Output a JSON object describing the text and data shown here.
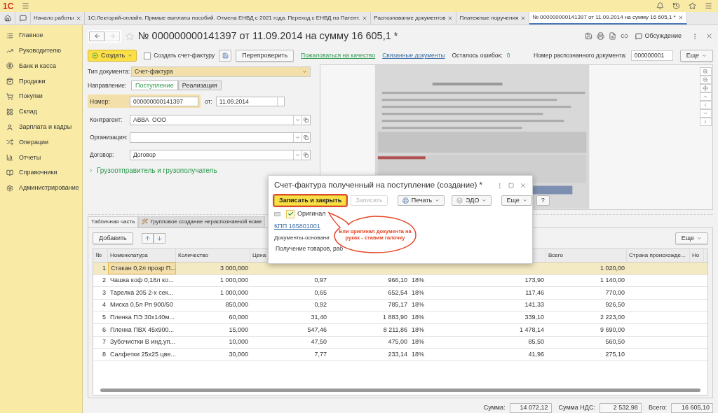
{
  "app_bar": {
    "logo": "1С"
  },
  "tabs": [
    {
      "label": "Начало работы",
      "selected": false
    },
    {
      "label": "1С:Лекторий-онлайн. Прямые выплаты пособий. Отмена ЕНВД с 2021 года. Переход с ЕНВД на Патент.",
      "selected": false
    },
    {
      "label": "Распознавание документов",
      "selected": false
    },
    {
      "label": "Платежные поручения",
      "selected": false
    },
    {
      "label": "№ 000000000141397 от 11.09.2014 на сумму 16 605,1 *",
      "selected": true
    }
  ],
  "sidebar": {
    "items": [
      {
        "label": "Главное"
      },
      {
        "label": "Руководителю"
      },
      {
        "label": "Банк и касса"
      },
      {
        "label": "Продажи"
      },
      {
        "label": "Покупки"
      },
      {
        "label": "Склад"
      },
      {
        "label": "Зарплата и кадры"
      },
      {
        "label": "Операции"
      },
      {
        "label": "Отчеты"
      },
      {
        "label": "Справочники"
      },
      {
        "label": "Администрирование"
      }
    ]
  },
  "document": {
    "title": "№ 000000000141397 от 11.09.2014 на сумму 16 605,1 *",
    "discussion": "Обсуждение"
  },
  "toolbar": {
    "create": "Создать",
    "create_invoice": {
      "label": "Создать счет-фактуру",
      "checked": false
    },
    "recheck": "Перепроверить",
    "complain": "Пожаловаться на качество",
    "related": "Связанные документы",
    "errors_label": "Осталось ошибок:",
    "errors_value": "0",
    "recognized_label": "Номер распознанного документа:",
    "recognized_value": "000000001",
    "more": "Еще"
  },
  "form": {
    "doc_type_label": "Тип документа:",
    "doc_type": "Счет-фактура",
    "direction_label": "Направление:",
    "directions": [
      {
        "label": "Поступление",
        "selected": true
      },
      {
        "label": "Реализация",
        "selected": false
      }
    ],
    "number_label": "Номер:",
    "number": "000000000141397",
    "date_label": "от:",
    "date": "11.09.2014",
    "fields": [
      {
        "label": "Контрагент:",
        "value": "АВВА  ООО"
      },
      {
        "label": "Организация:"
      },
      {
        "label": "Договор:",
        "value": "Договор"
      }
    ],
    "consignor": "Грузоотправитель и грузополучатель"
  },
  "table_tabs": [
    {
      "label": "Табличная часть",
      "selected": true
    },
    {
      "label": "Групповое создание нераспознанной номе",
      "selected": false
    }
  ],
  "table_toolbar": {
    "add": "Добавить",
    "more": "Еще"
  },
  "table": {
    "columns": [
      "№",
      "Номенклатура",
      "Количество",
      "Цена",
      "Всего",
      "Страна происхожде...",
      "Но"
    ],
    "rows": [
      {
        "n": "1",
        "name": "Стакан 0,2л прозр П...",
        "qty": "3 000,000",
        "total": "1 020,00",
        "selected": true
      },
      {
        "n": "2",
        "name": "Чашка коф 0,18л ко...",
        "qty": "1 000,000",
        "price": "0,97",
        "sum": "966,10",
        "rate": "18%",
        "vat": "173,90",
        "total": "1 140,00",
        "selected": false
      },
      {
        "n": "3",
        "name": "Тарелка 205 2-х сек...",
        "qty": "1 000,000",
        "price": "0,65",
        "sum": "652,54",
        "rate": "18%",
        "vat": "117,46",
        "total": "770,00",
        "selected": false
      },
      {
        "n": "4",
        "name": "Миска 0,5л Рп 900/50",
        "qty": "850,000",
        "price": "0,92",
        "sum": "785,17",
        "rate": "18%",
        "vat": "141,33",
        "total": "926,50",
        "selected": false
      },
      {
        "n": "5",
        "name": "Пленка ПЭ 30х140м...",
        "qty": "60,000",
        "price": "31,40",
        "sum": "1 883,90",
        "rate": "18%",
        "vat": "339,10",
        "total": "2 223,00",
        "selected": false
      },
      {
        "n": "6",
        "name": "Пленка ПВХ 45х900...",
        "qty": "15,000",
        "price": "547,46",
        "sum": "8 211,86",
        "rate": "18%",
        "vat": "1 478,14",
        "total": "9 690,00",
        "selected": false
      },
      {
        "n": "7",
        "name": "Зубочистки В инд.уп...",
        "qty": "10,000",
        "price": "47,50",
        "sum": "475,00",
        "rate": "18%",
        "vat": "85,50",
        "total": "560,50",
        "selected": false
      },
      {
        "n": "8",
        "name": "Салфетки 25х25 цве...",
        "qty": "30,000",
        "price": "7,77",
        "sum": "233,14",
        "rate": "18%",
        "vat": "41,96",
        "total": "275,10",
        "selected": false
      }
    ]
  },
  "totals": [
    {
      "label": "Сумма:",
      "value": "14 072,12"
    },
    {
      "label": "Сумма НДС:",
      "value": "2 532,98"
    },
    {
      "label": "Всего:",
      "value": "16 605,10"
    }
  ],
  "dialog": {
    "title": "Счет-фактура полученный на поступление (создание) *",
    "buttons": [
      {
        "kind": "primary",
        "label": "Записать и закрыть",
        "highlighted": true
      },
      {
        "kind": "disabled",
        "label": "Записать"
      },
      {
        "kind": "print",
        "label": "Печать"
      },
      {
        "kind": "edo",
        "label": "ЭДО"
      },
      {
        "kind": "menu",
        "label": "Еще"
      },
      {
        "kind": "plain",
        "label": "?"
      }
    ],
    "original": {
      "label": "Оригинал",
      "checked": true
    },
    "kpp_link": "КПП 165801001",
    "basis_label": "Документы-основани",
    "basis_value": "Получение товаров, раб",
    "callout": "Ели оригинал документа на руках - ставим галочку"
  }
}
